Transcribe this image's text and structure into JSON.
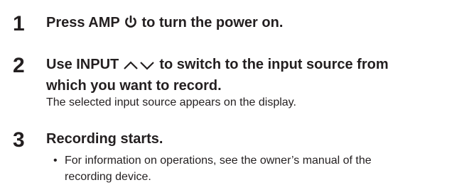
{
  "steps": [
    {
      "number": "1",
      "title_before": "Press AMP ",
      "title_icon": "power-icon",
      "title_after": " to turn the power on."
    },
    {
      "number": "2",
      "title_before": "Use INPUT ",
      "title_icon": "up-down-arrows-icon",
      "title_after": " to switch to the input source from",
      "title_line2": "which you want to record.",
      "description": "The selected input source appears on the display."
    },
    {
      "number": "3",
      "title": "Recording starts.",
      "bullet": "•",
      "bullet_line1": "For information on operations, see the owner’s manual of the",
      "bullet_line2": "recording device."
    }
  ]
}
